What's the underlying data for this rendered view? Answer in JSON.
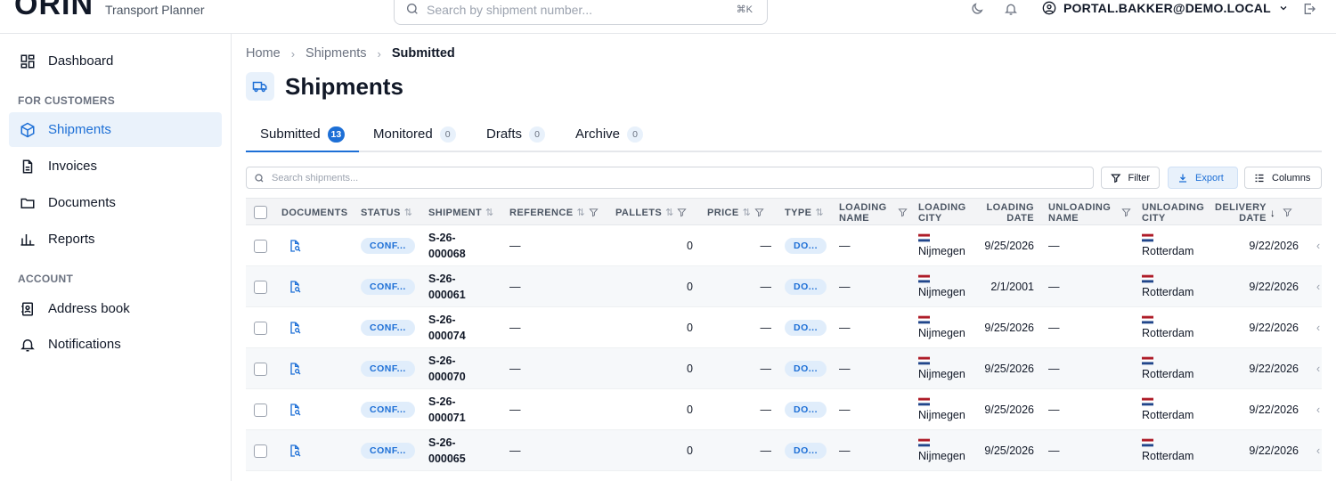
{
  "app": {
    "logo": "ORIN",
    "subtitle": "Transport Planner"
  },
  "topbar": {
    "search_placeholder": "Search by shipment number...",
    "search_shortcut": "⌘K",
    "user": "PORTAL.BAKKER@DEMO.LOCAL",
    "icons": [
      "moon-icon",
      "bell-icon",
      "user-circle-icon",
      "chevron-down-icon",
      "logout-icon"
    ]
  },
  "sidebar": {
    "dashboard": "Dashboard",
    "section_customers": "FOR CUSTOMERS",
    "shipments": "Shipments",
    "invoices": "Invoices",
    "documents": "Documents",
    "reports": "Reports",
    "section_account": "ACCOUNT",
    "address_book": "Address book",
    "notifications": "Notifications"
  },
  "breadcrumb": {
    "home": "Home",
    "shipments": "Shipments",
    "current": "Submitted"
  },
  "page": {
    "title": "Shipments"
  },
  "tabs": [
    {
      "label": "Submitted",
      "count": "13"
    },
    {
      "label": "Monitored",
      "count": "0"
    },
    {
      "label": "Drafts",
      "count": "0"
    },
    {
      "label": "Archive",
      "count": "0"
    }
  ],
  "toolbar": {
    "search_placeholder": "Search shipments...",
    "filter": "Filter",
    "export": "Export",
    "columns": "Columns"
  },
  "columns": {
    "documents": "DOCUMENTS",
    "status": "STATUS",
    "shipment": "SHIPMENT",
    "reference": "REFERENCE",
    "pallets": "PALLETS",
    "price": "PRICE",
    "type": "TYPE",
    "loading_name_1": "LOADING",
    "loading_name_2": "NAME",
    "loading_city_1": "LOADING",
    "loading_city_2": "CITY",
    "loading_date_1": "LOADING",
    "loading_date_2": "DATE",
    "unloading_name_1": "UNLOADING",
    "unloading_name_2": "NAME",
    "unloading_city_1": "UNLOADING",
    "unloading_city_2": "CITY",
    "delivery_date_1": "DELIVERY",
    "delivery_date_2": "DATE"
  },
  "rows": [
    {
      "status": "CONF...",
      "ship1": "S-26-",
      "ship2": "000068",
      "reference": "—",
      "pallets": "0",
      "price": "—",
      "type": "DO...",
      "loading_name": "—",
      "loading_city": "Nijmegen",
      "loading_date": "9/25/2026",
      "unloading_name": "—",
      "unloading_city": "Rotterdam",
      "delivery_date": "9/22/2026"
    },
    {
      "status": "CONF...",
      "ship1": "S-26-",
      "ship2": "000061",
      "reference": "—",
      "pallets": "0",
      "price": "—",
      "type": "DO...",
      "loading_name": "—",
      "loading_city": "Nijmegen",
      "loading_date": "2/1/2001",
      "unloading_name": "—",
      "unloading_city": "Rotterdam",
      "delivery_date": "9/22/2026"
    },
    {
      "status": "CONF...",
      "ship1": "S-26-",
      "ship2": "000074",
      "reference": "—",
      "pallets": "0",
      "price": "—",
      "type": "DO...",
      "loading_name": "—",
      "loading_city": "Nijmegen",
      "loading_date": "9/25/2026",
      "unloading_name": "—",
      "unloading_city": "Rotterdam",
      "delivery_date": "9/22/2026"
    },
    {
      "status": "CONF...",
      "ship1": "S-26-",
      "ship2": "000070",
      "reference": "—",
      "pallets": "0",
      "price": "—",
      "type": "DO...",
      "loading_name": "—",
      "loading_city": "Nijmegen",
      "loading_date": "9/25/2026",
      "unloading_name": "—",
      "unloading_city": "Rotterdam",
      "delivery_date": "9/22/2026"
    },
    {
      "status": "CONF...",
      "ship1": "S-26-",
      "ship2": "000071",
      "reference": "—",
      "pallets": "0",
      "price": "—",
      "type": "DO...",
      "loading_name": "—",
      "loading_city": "Nijmegen",
      "loading_date": "9/25/2026",
      "unloading_name": "—",
      "unloading_city": "Rotterdam",
      "delivery_date": "9/22/2026"
    },
    {
      "status": "CONF...",
      "ship1": "S-26-",
      "ship2": "000065",
      "reference": "—",
      "pallets": "0",
      "price": "—",
      "type": "DO...",
      "loading_name": "—",
      "loading_city": "Nijmegen",
      "loading_date": "9/25/2026",
      "unloading_name": "—",
      "unloading_city": "Rotterdam",
      "delivery_date": "9/22/2026"
    }
  ],
  "colors": {
    "accent": "#1d6fd6",
    "accent_light": "#e8f1fb",
    "flag_red": "#ae1c28",
    "flag_blue": "#21468b"
  }
}
